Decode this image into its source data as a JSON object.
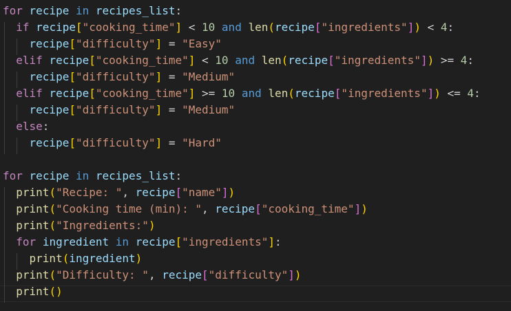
{
  "editor": {
    "language": "python",
    "colors": {
      "background": "#1f1f1f",
      "keyword_flow": "#c586c0",
      "keyword": "#569cd6",
      "variable": "#9cdcfe",
      "function": "#dcdcaa",
      "string": "#ce9178",
      "number": "#b5cea8",
      "bracket_level_1": "#ffd700",
      "bracket_level_2": "#da70d6",
      "bracket_level_3": "#179fff"
    },
    "lines": [
      [
        {
          "t": "kw-flow",
          "v": "for"
        },
        {
          "t": "",
          "v": " "
        },
        {
          "t": "var",
          "v": "recipe"
        },
        {
          "t": "",
          "v": " "
        },
        {
          "t": "kw",
          "v": "in"
        },
        {
          "t": "",
          "v": " "
        },
        {
          "t": "var",
          "v": "recipes_list"
        },
        {
          "t": "op",
          "v": ":"
        }
      ],
      [
        {
          "t": "",
          "v": "  "
        },
        {
          "t": "kw-flow",
          "v": "if"
        },
        {
          "t": "",
          "v": " "
        },
        {
          "t": "var",
          "v": "recipe"
        },
        {
          "t": "b1",
          "v": "["
        },
        {
          "t": "str",
          "v": "\"cooking_time\""
        },
        {
          "t": "b1",
          "v": "]"
        },
        {
          "t": "op",
          "v": " < "
        },
        {
          "t": "num",
          "v": "10"
        },
        {
          "t": "",
          "v": " "
        },
        {
          "t": "kw",
          "v": "and"
        },
        {
          "t": "",
          "v": " "
        },
        {
          "t": "fn",
          "v": "len"
        },
        {
          "t": "b1",
          "v": "("
        },
        {
          "t": "var",
          "v": "recipe"
        },
        {
          "t": "b2",
          "v": "["
        },
        {
          "t": "str",
          "v": "\"ingredients\""
        },
        {
          "t": "b2",
          "v": "]"
        },
        {
          "t": "b1",
          "v": ")"
        },
        {
          "t": "op",
          "v": " < "
        },
        {
          "t": "num",
          "v": "4"
        },
        {
          "t": "op",
          "v": ":"
        }
      ],
      [
        {
          "t": "",
          "v": "    "
        },
        {
          "t": "var",
          "v": "recipe"
        },
        {
          "t": "b1",
          "v": "["
        },
        {
          "t": "str",
          "v": "\"difficulty\""
        },
        {
          "t": "b1",
          "v": "]"
        },
        {
          "t": "op",
          "v": " = "
        },
        {
          "t": "str",
          "v": "\"Easy\""
        }
      ],
      [
        {
          "t": "",
          "v": "  "
        },
        {
          "t": "kw-flow",
          "v": "elif"
        },
        {
          "t": "",
          "v": " "
        },
        {
          "t": "var",
          "v": "recipe"
        },
        {
          "t": "b1",
          "v": "["
        },
        {
          "t": "str",
          "v": "\"cooking_time\""
        },
        {
          "t": "b1",
          "v": "]"
        },
        {
          "t": "op",
          "v": " < "
        },
        {
          "t": "num",
          "v": "10"
        },
        {
          "t": "",
          "v": " "
        },
        {
          "t": "kw",
          "v": "and"
        },
        {
          "t": "",
          "v": " "
        },
        {
          "t": "fn",
          "v": "len"
        },
        {
          "t": "b1",
          "v": "("
        },
        {
          "t": "var",
          "v": "recipe"
        },
        {
          "t": "b2",
          "v": "["
        },
        {
          "t": "str",
          "v": "\"ingredients\""
        },
        {
          "t": "b2",
          "v": "]"
        },
        {
          "t": "b1",
          "v": ")"
        },
        {
          "t": "op",
          "v": " >= "
        },
        {
          "t": "num",
          "v": "4"
        },
        {
          "t": "op",
          "v": ":"
        }
      ],
      [
        {
          "t": "",
          "v": "    "
        },
        {
          "t": "var",
          "v": "recipe"
        },
        {
          "t": "b1",
          "v": "["
        },
        {
          "t": "str",
          "v": "\"difficulty\""
        },
        {
          "t": "b1",
          "v": "]"
        },
        {
          "t": "op",
          "v": " = "
        },
        {
          "t": "str",
          "v": "\"Medium\""
        }
      ],
      [
        {
          "t": "",
          "v": "  "
        },
        {
          "t": "kw-flow",
          "v": "elif"
        },
        {
          "t": "",
          "v": " "
        },
        {
          "t": "var",
          "v": "recipe"
        },
        {
          "t": "b1",
          "v": "["
        },
        {
          "t": "str",
          "v": "\"cooking_time\""
        },
        {
          "t": "b1",
          "v": "]"
        },
        {
          "t": "op",
          "v": " >= "
        },
        {
          "t": "num",
          "v": "10"
        },
        {
          "t": "",
          "v": " "
        },
        {
          "t": "kw",
          "v": "and"
        },
        {
          "t": "",
          "v": " "
        },
        {
          "t": "fn",
          "v": "len"
        },
        {
          "t": "b1",
          "v": "("
        },
        {
          "t": "var",
          "v": "recipe"
        },
        {
          "t": "b2",
          "v": "["
        },
        {
          "t": "str",
          "v": "\"ingredients\""
        },
        {
          "t": "b2",
          "v": "]"
        },
        {
          "t": "b1",
          "v": ")"
        },
        {
          "t": "op",
          "v": " <= "
        },
        {
          "t": "num",
          "v": "4"
        },
        {
          "t": "op",
          "v": ":"
        }
      ],
      [
        {
          "t": "",
          "v": "    "
        },
        {
          "t": "var",
          "v": "recipe"
        },
        {
          "t": "b1",
          "v": "["
        },
        {
          "t": "str",
          "v": "\"difficulty\""
        },
        {
          "t": "b1",
          "v": "]"
        },
        {
          "t": "op",
          "v": " = "
        },
        {
          "t": "str",
          "v": "\"Medium\""
        }
      ],
      [
        {
          "t": "",
          "v": "  "
        },
        {
          "t": "kw-flow",
          "v": "else"
        },
        {
          "t": "op",
          "v": ":"
        }
      ],
      [
        {
          "t": "",
          "v": "    "
        },
        {
          "t": "var",
          "v": "recipe"
        },
        {
          "t": "b1",
          "v": "["
        },
        {
          "t": "str",
          "v": "\"difficulty\""
        },
        {
          "t": "b1",
          "v": "]"
        },
        {
          "t": "op",
          "v": " = "
        },
        {
          "t": "str",
          "v": "\"Hard\""
        }
      ],
      [],
      [
        {
          "t": "kw-flow",
          "v": "for"
        },
        {
          "t": "",
          "v": " "
        },
        {
          "t": "var",
          "v": "recipe"
        },
        {
          "t": "",
          "v": " "
        },
        {
          "t": "kw",
          "v": "in"
        },
        {
          "t": "",
          "v": " "
        },
        {
          "t": "var",
          "v": "recipes_list"
        },
        {
          "t": "op",
          "v": ":"
        }
      ],
      [
        {
          "t": "",
          "v": "  "
        },
        {
          "t": "fn",
          "v": "print"
        },
        {
          "t": "b1",
          "v": "("
        },
        {
          "t": "str",
          "v": "\"Recipe: \""
        },
        {
          "t": "op",
          "v": ", "
        },
        {
          "t": "var",
          "v": "recipe"
        },
        {
          "t": "b2",
          "v": "["
        },
        {
          "t": "str",
          "v": "\"name\""
        },
        {
          "t": "b2",
          "v": "]"
        },
        {
          "t": "b1",
          "v": ")"
        }
      ],
      [
        {
          "t": "",
          "v": "  "
        },
        {
          "t": "fn",
          "v": "print"
        },
        {
          "t": "b1",
          "v": "("
        },
        {
          "t": "str",
          "v": "\"Cooking time (min): \""
        },
        {
          "t": "op",
          "v": ", "
        },
        {
          "t": "var",
          "v": "recipe"
        },
        {
          "t": "b2",
          "v": "["
        },
        {
          "t": "str",
          "v": "\"cooking_time\""
        },
        {
          "t": "b2",
          "v": "]"
        },
        {
          "t": "b1",
          "v": ")"
        }
      ],
      [
        {
          "t": "",
          "v": "  "
        },
        {
          "t": "fn",
          "v": "print"
        },
        {
          "t": "b1",
          "v": "("
        },
        {
          "t": "str",
          "v": "\"Ingredients:\""
        },
        {
          "t": "b1",
          "v": ")"
        }
      ],
      [
        {
          "t": "",
          "v": "  "
        },
        {
          "t": "kw-flow",
          "v": "for"
        },
        {
          "t": "",
          "v": " "
        },
        {
          "t": "var",
          "v": "ingredient"
        },
        {
          "t": "",
          "v": " "
        },
        {
          "t": "kw",
          "v": "in"
        },
        {
          "t": "",
          "v": " "
        },
        {
          "t": "var",
          "v": "recipe"
        },
        {
          "t": "b1",
          "v": "["
        },
        {
          "t": "str",
          "v": "\"ingredients\""
        },
        {
          "t": "b1",
          "v": "]"
        },
        {
          "t": "op",
          "v": ":"
        }
      ],
      [
        {
          "t": "",
          "v": "    "
        },
        {
          "t": "fn",
          "v": "print"
        },
        {
          "t": "b1",
          "v": "("
        },
        {
          "t": "var",
          "v": "ingredient"
        },
        {
          "t": "b1",
          "v": ")"
        }
      ],
      [
        {
          "t": "",
          "v": "  "
        },
        {
          "t": "fn",
          "v": "print"
        },
        {
          "t": "b1",
          "v": "("
        },
        {
          "t": "str",
          "v": "\"Difficulty: \""
        },
        {
          "t": "op",
          "v": ", "
        },
        {
          "t": "var",
          "v": "recipe"
        },
        {
          "t": "b2",
          "v": "["
        },
        {
          "t": "str",
          "v": "\"difficulty\""
        },
        {
          "t": "b2",
          "v": "]"
        },
        {
          "t": "b1",
          "v": ")"
        }
      ],
      [
        {
          "t": "",
          "v": "  "
        },
        {
          "t": "fn",
          "v": "print"
        },
        {
          "t": "b1",
          "v": "()"
        }
      ]
    ]
  }
}
